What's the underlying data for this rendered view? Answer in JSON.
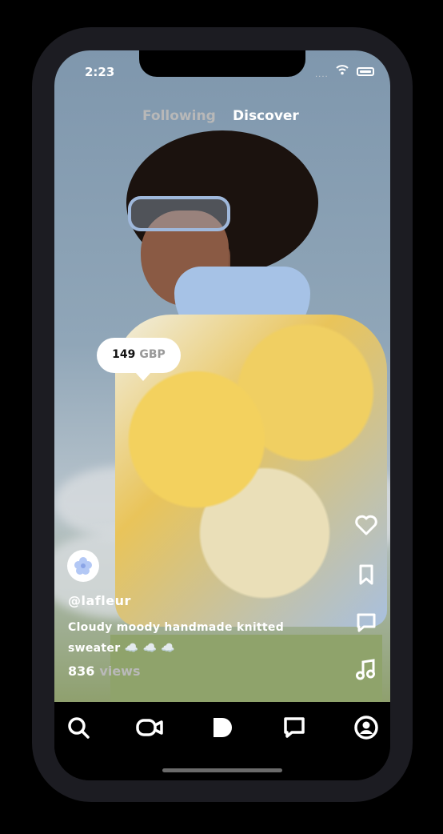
{
  "status_bar": {
    "time": "2:23",
    "signal": "....",
    "icons": [
      "wifi-icon",
      "battery-icon"
    ]
  },
  "feed_tabs": [
    {
      "label": "Following",
      "active": false
    },
    {
      "label": "Discover",
      "active": true
    }
  ],
  "post": {
    "price_amount": "149",
    "price_currency": "GBP",
    "username": "@lafleur",
    "caption": "Cloudy moody handmade knitted sweater ☁️ ☁️ ☁️",
    "views_count": "836",
    "views_label": "views"
  },
  "side_actions": [
    "heart-icon",
    "bookmark-icon",
    "comment-icon",
    "music-note-icon"
  ],
  "bottom_nav": [
    "search-icon",
    "video-camera-icon",
    "play-icon",
    "messages-icon",
    "profile-icon"
  ],
  "colors": {
    "accent": "#ffffff",
    "phone_frame": "#1c1c22",
    "price_tag": "#ffffff"
  }
}
